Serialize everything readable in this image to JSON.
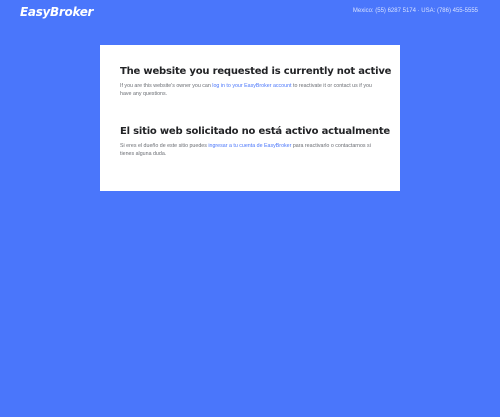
{
  "header": {
    "logo_text": "EasyBroker",
    "contact_text": "Mexico: (55) 6287 5174 · USA: (786) 455-5555"
  },
  "notice_en": {
    "title": "The website you requested is currently not active",
    "text_before": "If you are this website's owner you can ",
    "link_text": "log in to your EasyBroker account",
    "text_after": " to reactivate it or contact us if you have any questions."
  },
  "notice_es": {
    "title": "El sitio web solicitado no está activo actualmente",
    "text_before": "Si eres el dueño de este sitio puedes ",
    "link_text": "ingresar a tu cuenta de EasyBroker",
    "text_after": " para reactivarlo o contactarnos si tienes alguna duda."
  },
  "colors": {
    "background": "#4a76fb",
    "card": "#ffffff",
    "link": "#4a76fb"
  }
}
